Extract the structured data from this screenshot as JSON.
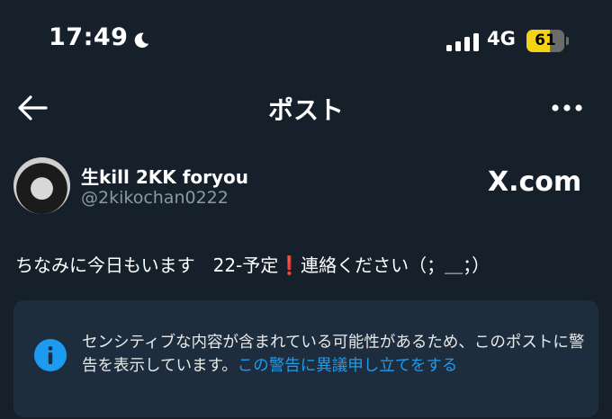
{
  "status_bar": {
    "time": "17:49",
    "network": "4G",
    "battery_level": "61",
    "battery_fraction": 0.61,
    "icons": [
      "moon-icon",
      "signal-icon",
      "battery-icon"
    ]
  },
  "nav": {
    "title": "ポスト",
    "back_icon": "back-arrow-icon",
    "more_icon": "more-options-icon"
  },
  "post": {
    "display_name": "生kill 2KK foryou",
    "handle": "@2kikochan0222",
    "source": "X.com",
    "text": "ちなみに今日もいます　22-予定❗️連絡ください（；＿；）"
  },
  "notice": {
    "text": "センシティブな内容が含まれている可能性があるため、このポストに警告を表示しています。",
    "link": "この警告に異議申し立てをする",
    "icon": "info-icon"
  },
  "colors": {
    "background": "#15202b",
    "card": "#1e2d3d",
    "accent": "#1d9bf0",
    "secondary_text": "#8b98a5",
    "battery": "#f6d215"
  }
}
